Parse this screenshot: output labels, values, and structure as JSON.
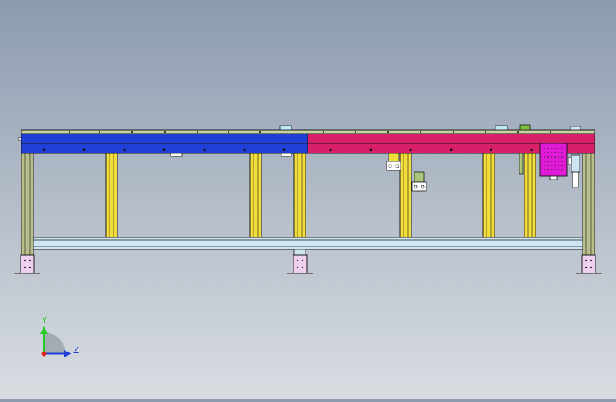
{
  "viewport": {
    "background_top": "#8c9bb0",
    "background_bottom": "#d9dde2"
  },
  "model": {
    "conveyor_left_color": "#1f3fd6",
    "conveyor_right_color": "#d6206a",
    "frame_color": "#b8bf8a",
    "leg_color": "#f2dd3a",
    "rail_color": "#cfe6f2",
    "foot_color": "#f0d0ef",
    "control_box_color": "#e01ad6",
    "outline_color": "#1a1a1a"
  },
  "triad": {
    "y_label": "Y",
    "z_label": "Z",
    "y_color": "#22cc22",
    "z_color": "#1f3fd6",
    "x_color": "#dd2222"
  }
}
